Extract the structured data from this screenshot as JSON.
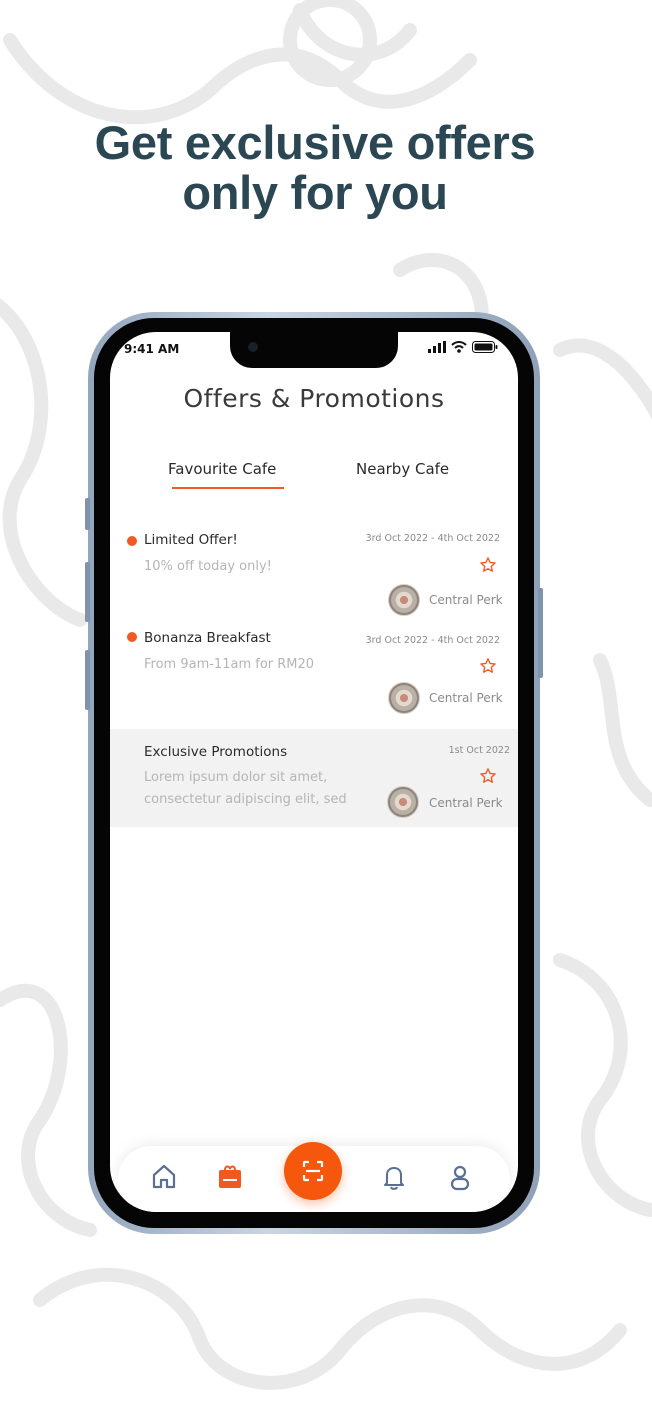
{
  "headline": {
    "line1": "Get exclusive offers",
    "line2": "only for you"
  },
  "status_bar": {
    "time": "9:41 AM"
  },
  "screen": {
    "title": "Offers & Promotions",
    "tabs": [
      {
        "label": "Favourite Cafe",
        "active": true
      },
      {
        "label": "Nearby Cafe",
        "active": false
      }
    ],
    "offers": [
      {
        "title": "Limited Offer!",
        "description": "10% off today only!",
        "date": "3rd Oct 2022 - 4th Oct 2022",
        "cafe": "Central Perk",
        "unread": true
      },
      {
        "title": "Bonanza Breakfast",
        "description": "From 9am-11am for RM20",
        "date": "3rd Oct 2022 - 4th Oct 2022",
        "cafe": "Central Perk",
        "unread": true
      },
      {
        "title": "Exclusive Promotions",
        "description_line1": "Lorem ipsum dolor sit amet,",
        "description_line2": "consectetur adipiscing elit, sed",
        "date": "1st Oct 2022",
        "cafe": "Central Perk",
        "unread": false
      }
    ]
  },
  "bottom_nav": {
    "items": [
      "home-icon",
      "offers-bag-icon",
      "scan-icon",
      "bell-icon",
      "profile-icon"
    ],
    "active": "offers-bag-icon"
  },
  "colors": {
    "accent": "#f05a22",
    "headline": "#2c4754",
    "nav_icon": "#5a6f93",
    "highlight_row": "#f2f2f2"
  }
}
